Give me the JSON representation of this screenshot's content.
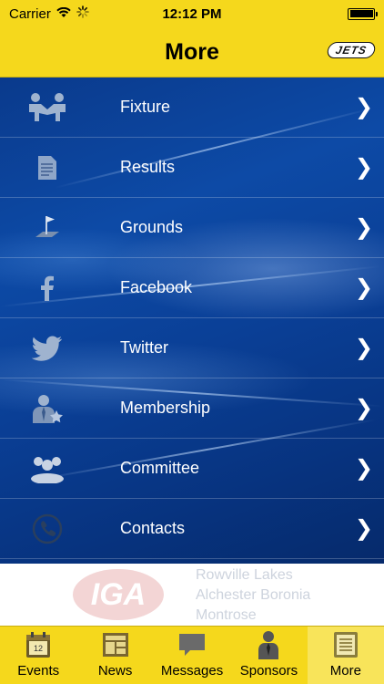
{
  "status_bar": {
    "carrier": "Carrier",
    "time": "12:12 PM",
    "wifi_icon": "wifi-icon",
    "activity_icon": "activity-spinner-icon",
    "battery_level": 1.0
  },
  "nav": {
    "title": "More",
    "logo_text": "JETS"
  },
  "menu": {
    "items": [
      {
        "label": "Fixture",
        "icon": "handshake-icon"
      },
      {
        "label": "Results",
        "icon": "document-icon"
      },
      {
        "label": "Grounds",
        "icon": "flag-icon"
      },
      {
        "label": "Facebook",
        "icon": "facebook-icon"
      },
      {
        "label": "Twitter",
        "icon": "twitter-bird-icon"
      },
      {
        "label": "Membership",
        "icon": "member-icon"
      },
      {
        "label": "Committee",
        "icon": "group-icon"
      },
      {
        "label": "Contacts",
        "icon": "phone-icon"
      }
    ],
    "chevron": "❯"
  },
  "sponsor": {
    "logo_text": "IGA",
    "lines": [
      "Rowville Lakes",
      "Alchester Boronia",
      "Montrose"
    ]
  },
  "tabs": [
    {
      "label": "Events",
      "icon": "calendar-icon",
      "badge": "12"
    },
    {
      "label": "News",
      "icon": "newspaper-icon"
    },
    {
      "label": "Messages",
      "icon": "speech-bubble-icon"
    },
    {
      "label": "Sponsors",
      "icon": "businessman-icon"
    },
    {
      "label": "More",
      "icon": "list-icon"
    }
  ],
  "colors": {
    "bar_yellow": "#f5d81c",
    "menu_blue": "#0a3f96"
  }
}
